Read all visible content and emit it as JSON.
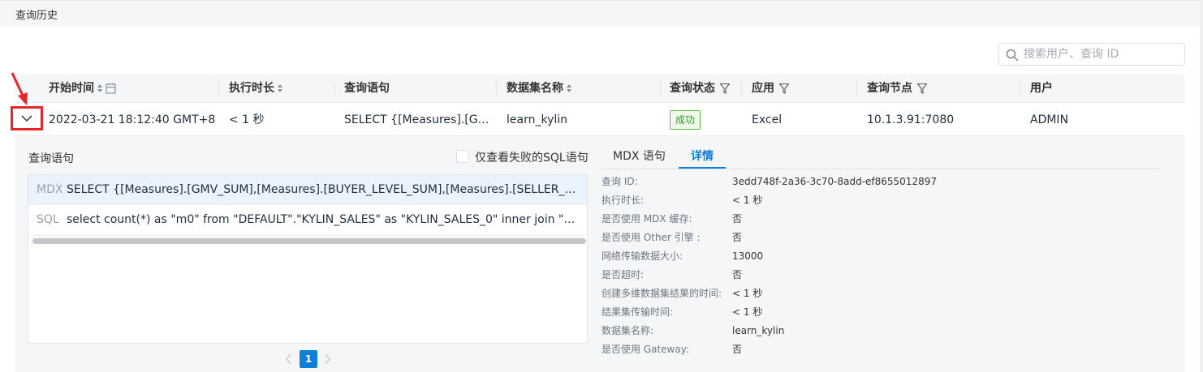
{
  "page": {
    "title": "查询历史"
  },
  "search": {
    "placeholder": "搜索用户、查询 ID",
    "value": ""
  },
  "table": {
    "headers": {
      "start_time": "开始时间",
      "duration": "执行时长",
      "query": "查询语句",
      "dataset": "数据集名称",
      "status": "查询状态",
      "app": "应用",
      "node": "查询节点",
      "user": "用户"
    },
    "rows": [
      {
        "start_time": "2022-03-21 18:12:40 GMT+8",
        "duration": "< 1 秒",
        "query": "SELECT {[Measures].[GM…",
        "dataset": "learn_kylin",
        "status": "成功",
        "app": "Excel",
        "node": "10.1.3.91:7080",
        "user": "ADMIN"
      }
    ]
  },
  "details": {
    "section_title": "查询语句",
    "fail_only_label": "仅查看失败的SQL语句",
    "fail_only_checked": false,
    "queries": [
      {
        "type": "MDX",
        "text": "SELECT {[Measures].[GMV_SUM],[Measures].[BUYER_LEVEL_SUM],[Measures].[SELLER_LEV…"
      },
      {
        "type": "SQL",
        "text": "select count(*) as \"m0\" from \"DEFAULT\".\"KYLIN_SALES\" as \"KYLIN_SALES_0\" inner join \"DE…"
      }
    ],
    "pagination": {
      "current": "1"
    },
    "tabs": [
      {
        "label": "MDX 语句",
        "active": false
      },
      {
        "label": "详情",
        "active": true
      }
    ],
    "fields": [
      {
        "key": "查询 ID:",
        "value": "3edd748f-2a36-3c70-8add-ef8655012897"
      },
      {
        "key": "执行时长:",
        "value": "< 1 秒"
      },
      {
        "key": "是否使用 MDX 缓存:",
        "value": "否"
      },
      {
        "key": "是否使用 Other 引擎 :",
        "value": "否"
      },
      {
        "key": "网络传输数据大小:",
        "value": "13000"
      },
      {
        "key": "是否超时:",
        "value": "否"
      },
      {
        "key": "创建多维数据集结果的时间:",
        "value": "< 1 秒"
      },
      {
        "key": "结果集传输时间:",
        "value": "< 1 秒"
      },
      {
        "key": "数据集名称:",
        "value": "learn_kylin"
      },
      {
        "key": "是否使用 Gateway:",
        "value": "否"
      }
    ]
  },
  "colors": {
    "accent": "#0f80d6",
    "success": "#5cbf3d",
    "highlight": "#e8262a"
  }
}
